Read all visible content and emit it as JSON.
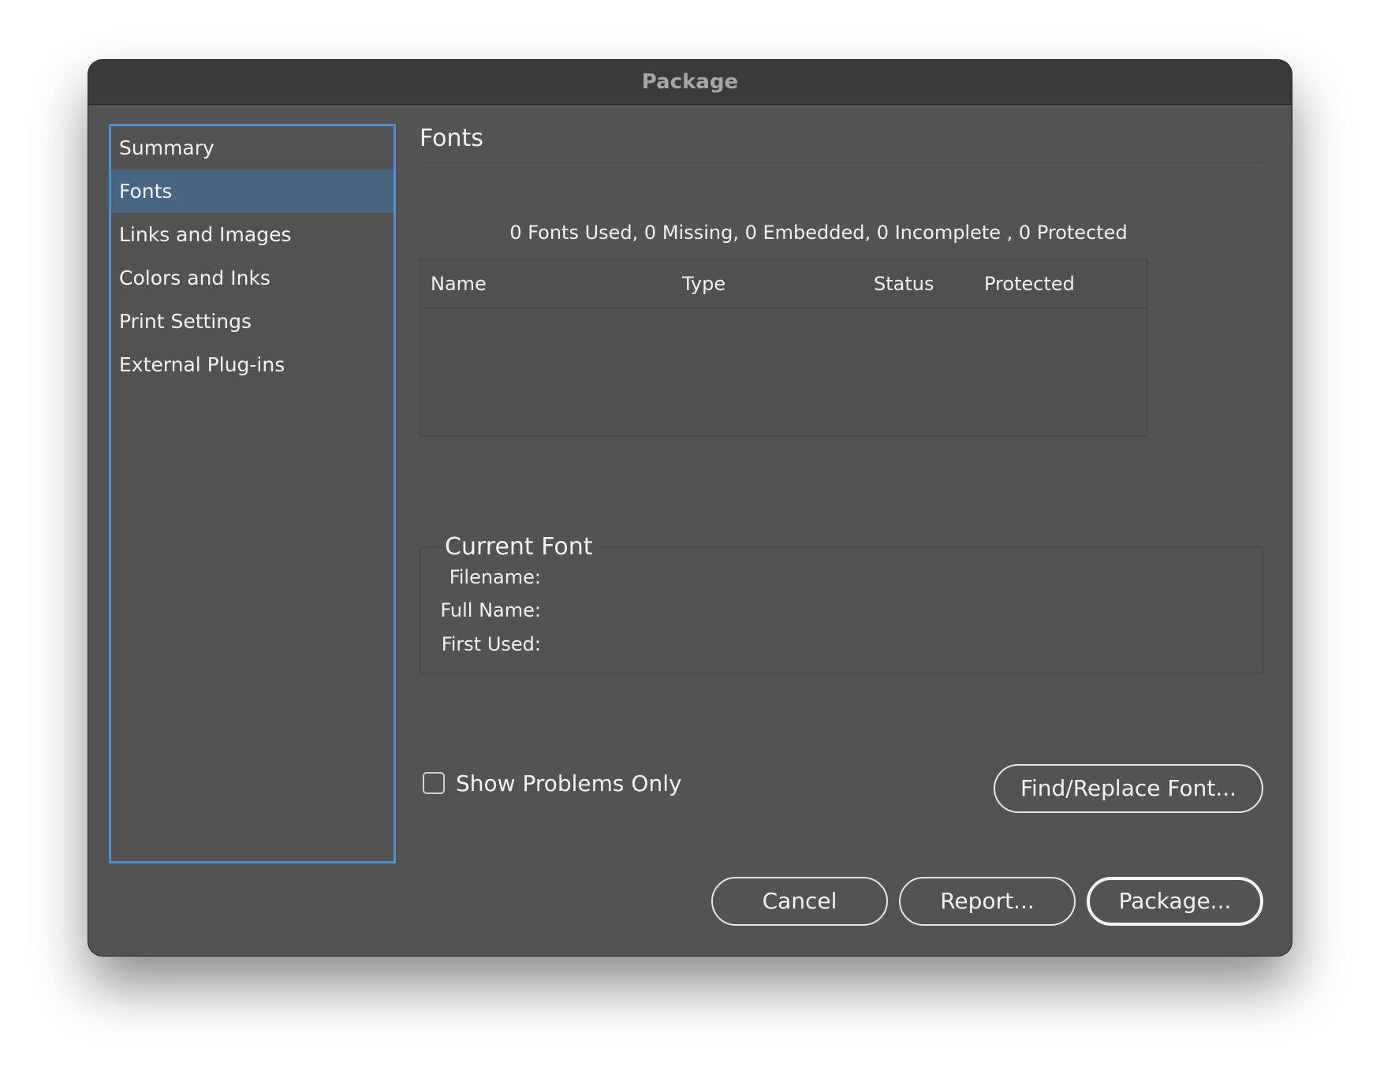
{
  "window": {
    "title": "Package"
  },
  "sidebar": {
    "items": [
      {
        "label": "Summary",
        "selected": false
      },
      {
        "label": "Fonts",
        "selected": true
      },
      {
        "label": "Links and Images",
        "selected": false
      },
      {
        "label": "Colors and Inks",
        "selected": false
      },
      {
        "label": "Print Settings",
        "selected": false
      },
      {
        "label": "External Plug-ins",
        "selected": false
      }
    ]
  },
  "main": {
    "section_title": "Fonts",
    "summary": "0 Fonts Used, 0 Missing, 0 Embedded, 0 Incomplete , 0 Protected",
    "table": {
      "columns": [
        "Name",
        "Type",
        "Status",
        "Protected"
      ],
      "rows": []
    },
    "current_font": {
      "legend": "Current Font",
      "filename_label": "Filename:",
      "fullname_label": "Full Name:",
      "first_used_label": "First Used:"
    },
    "show_problems_only": {
      "label": "Show Problems Only",
      "checked": false
    },
    "find_replace_label": "Find/Replace Font..."
  },
  "footer": {
    "cancel_label": "Cancel",
    "report_label": "Report...",
    "package_label": "Package..."
  },
  "colors": {
    "dialog_bg": "#535353",
    "titlebar_bg": "#3a3a3b",
    "selection_bg": "#4a6582",
    "focus_ring": "#4a8fd6"
  }
}
